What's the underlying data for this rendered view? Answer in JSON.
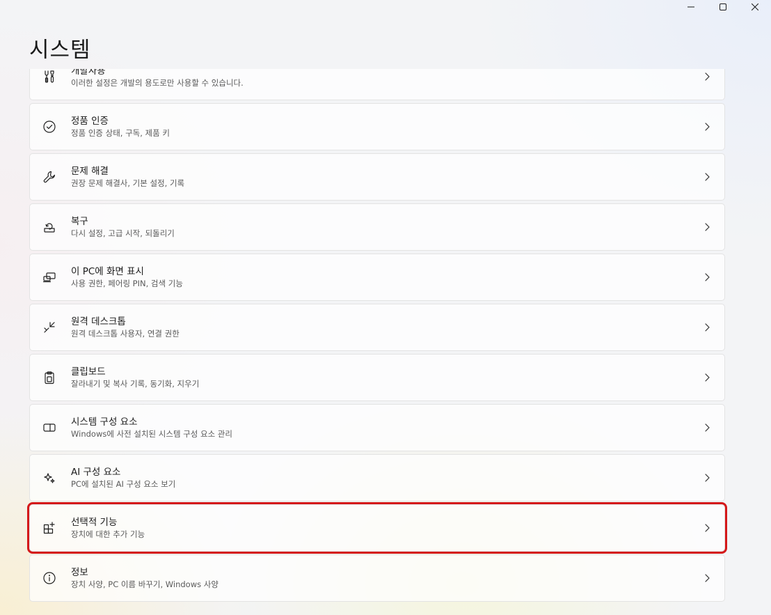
{
  "window": {
    "title": "시스템",
    "controls": {
      "minimize": "minimize-icon",
      "maximize": "maximize-icon",
      "close": "close-icon"
    }
  },
  "items": [
    {
      "title": "개발자용",
      "description": "이러한 설정은 개발의 용도로만 사용할 수 있습니다.",
      "icon": "developer-tools-icon"
    },
    {
      "title": "정품 인증",
      "description": "정품 인증 상태, 구독, 제품 키",
      "icon": "activation-check-icon"
    },
    {
      "title": "문제 해결",
      "description": "권장 문제 해결사, 기본 설정, 기록",
      "icon": "wrench-icon"
    },
    {
      "title": "복구",
      "description": "다시 설정, 고급 시작, 되돌리기",
      "icon": "recovery-icon"
    },
    {
      "title": "이 PC에 화면 표시",
      "description": "사용 권한, 페어링 PIN, 검색 기능",
      "icon": "project-to-pc-icon"
    },
    {
      "title": "원격 데스크톱",
      "description": "원격 데스크톱 사용자, 연결 권한",
      "icon": "remote-desktop-icon"
    },
    {
      "title": "클립보드",
      "description": "잘라내기 및 복사 기록, 동기화, 지우기",
      "icon": "clipboard-icon"
    },
    {
      "title": "시스템 구성 요소",
      "description": "Windows에 사전 설치된 시스템 구성 요소 관리",
      "icon": "system-components-icon"
    },
    {
      "title": "AI 구성 요소",
      "description": "PC에 설치된 AI 구성 요소 보기",
      "icon": "ai-sparkle-icon"
    },
    {
      "title": "선택적 기능",
      "description": "장치에 대한 추가 기능",
      "icon": "optional-features-icon",
      "highlighted": true
    },
    {
      "title": "정보",
      "description": "장치 사양, PC 이름 바꾸기, Windows 사양",
      "icon": "info-icon"
    }
  ],
  "colors": {
    "highlight": "#d4181a"
  }
}
